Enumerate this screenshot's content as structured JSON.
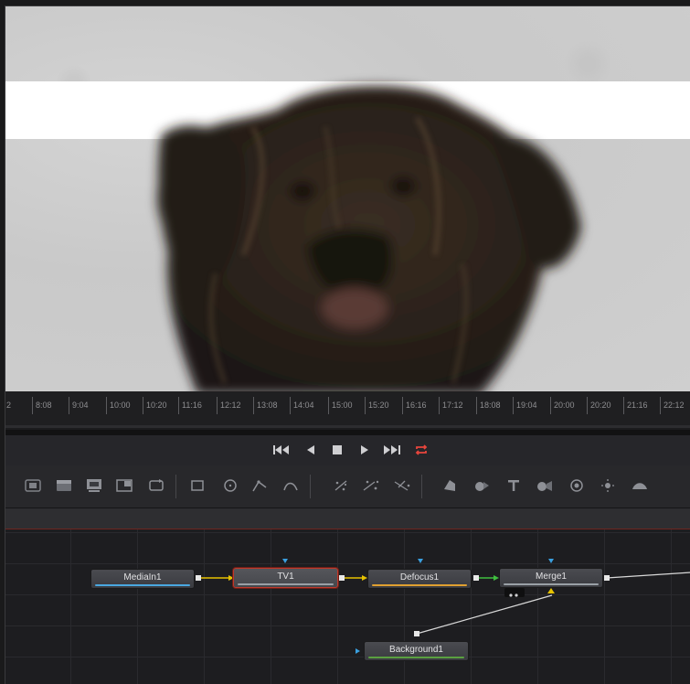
{
  "viewer": {
    "description_icon": "dog-image"
  },
  "timeline": {
    "ticks": [
      "2",
      "8:08",
      "9:04",
      "10:00",
      "10:20",
      "11:16",
      "12:12",
      "13:08",
      "14:04",
      "15:00",
      "15:20",
      "16:16",
      "17:12",
      "18:08",
      "19:04",
      "20:00",
      "20:20",
      "21:16",
      "22:12"
    ]
  },
  "transport": {
    "buttons": [
      "skip-to-start",
      "step-back",
      "stop",
      "play",
      "skip-to-end",
      "loop"
    ],
    "loop_color": "#e8453c"
  },
  "toolbar": {
    "tools": [
      "media-in",
      "media-out",
      "viewer-output",
      "merge",
      "transform",
      "rectangle",
      "ellipse",
      "polygon",
      "bspline",
      "particle-emitter",
      "particle-render",
      "particle-kill",
      "shape-3d",
      "merge-3d",
      "text-3d",
      "camera-3d",
      "renderer-3d",
      "light-3d",
      "image-plane-3d"
    ]
  },
  "nodes": {
    "mediain": {
      "label": "MediaIn1",
      "color": "#4aa8e0"
    },
    "tv": {
      "label": "TV1",
      "color": "#9aa0a6"
    },
    "defocus": {
      "label": "Defocus1",
      "color": "#e0a030"
    },
    "merge": {
      "label": "Merge1",
      "color": "#9aa0a6"
    },
    "background": {
      "label": "Background1",
      "color": "#5aa040"
    }
  },
  "colors": {
    "accent_red": "#c0392b",
    "wire_yellow": "#e6c200",
    "wire_green": "#3fbf3f",
    "input_blue": "#3aa0e0"
  }
}
